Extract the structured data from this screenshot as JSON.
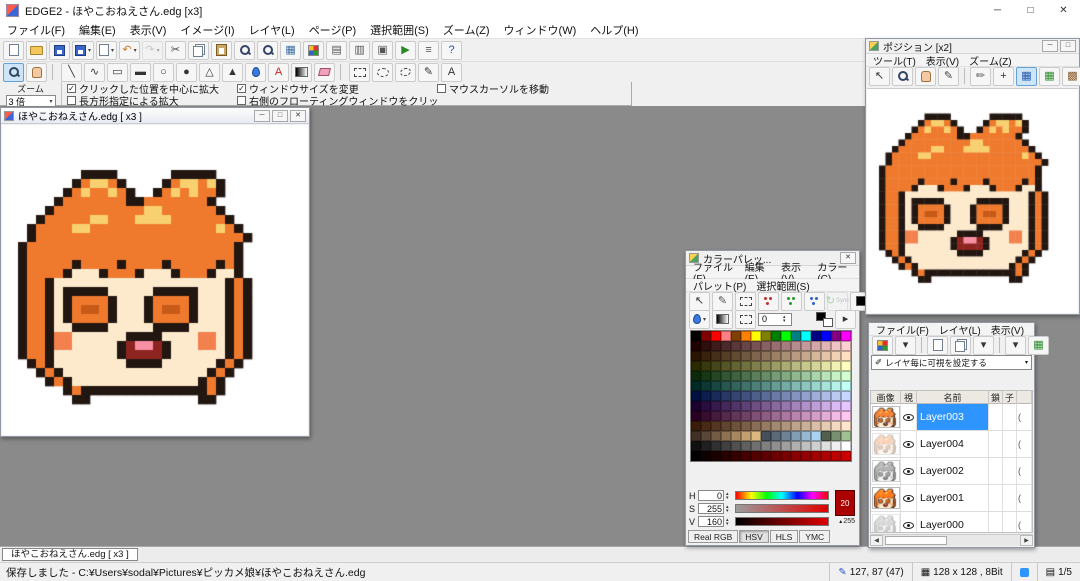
{
  "icons": {
    "dropdown": "▾",
    "check": "✓",
    "up": "▴",
    "down": "▾",
    "left": "◀",
    "right": "▶",
    "expand": "▸"
  },
  "colors": {
    "selected_layer": "#2e95ff",
    "workspace": "#8a8a8a",
    "titlebar": "#ffffff",
    "toolbar": "#f0f0f0",
    "canvas_bg": "#ffffff",
    "pressed_tool": "#cde6f7",
    "current_color": "#aa0000"
  },
  "window": {
    "title": "EDGE2 - ほやこおねえさん.edg [x3]",
    "controls": [
      {
        "name": "minimize-button",
        "glyph": "─"
      },
      {
        "name": "maximize-button",
        "glyph": "□"
      },
      {
        "name": "close-button",
        "glyph": "✕"
      }
    ]
  },
  "menubar": [
    {
      "id": "file",
      "label": "ファイル(F)"
    },
    {
      "id": "edit",
      "label": "編集(E)"
    },
    {
      "id": "view",
      "label": "表示(V)"
    },
    {
      "id": "image",
      "label": "イメージ(I)"
    },
    {
      "id": "layer",
      "label": "レイヤ(L)"
    },
    {
      "id": "page",
      "label": "ページ(P)"
    },
    {
      "id": "selection",
      "label": "選択範囲(S)"
    },
    {
      "id": "zoom",
      "label": "ズーム(Z)"
    },
    {
      "id": "window",
      "label": "ウィンドウ(W)"
    },
    {
      "id": "help",
      "label": "ヘルプ(H)"
    }
  ],
  "toolbar_main": [
    {
      "name": "new-file-button",
      "icon": "page"
    },
    {
      "name": "open-file-button",
      "icon": "folder"
    },
    {
      "name": "save-file-button",
      "icon": "floppy"
    },
    {
      "name": "save-as-button",
      "icon": "floppy",
      "arrow": true
    },
    {
      "name": "export-page-button",
      "icon": "page",
      "arrow": true
    },
    {
      "name": "undo-button",
      "icon": "glyph",
      "glyph": "↶",
      "color": "#c87820",
      "arrow": true
    },
    {
      "name": "redo-button",
      "icon": "glyph",
      "glyph": "↷",
      "color": "#999999",
      "arrow": true,
      "disabled": true
    },
    {
      "name": "cut-button",
      "icon": "glyph",
      "glyph": "✂",
      "color": "#444444"
    },
    {
      "name": "copy-button",
      "icon": "copy"
    },
    {
      "name": "paste-button",
      "icon": "paste"
    },
    {
      "name": "zoom-in-button",
      "icon": "mag"
    },
    {
      "name": "zoom-out-button",
      "icon": "mag"
    },
    {
      "name": "grid-button",
      "icon": "glyph",
      "glyph": "▦",
      "color": "#3a6ea5"
    },
    {
      "name": "palette-button",
      "icon": "palette"
    },
    {
      "name": "pages-button",
      "icon": "glyph",
      "glyph": "▤",
      "color": "#555555"
    },
    {
      "name": "tile-windows-button",
      "icon": "glyph",
      "glyph": "▥",
      "color": "#555555"
    },
    {
      "name": "cascade-windows-button",
      "icon": "glyph",
      "glyph": "▣",
      "color": "#555555"
    },
    {
      "name": "play-animation-button",
      "icon": "glyph",
      "glyph": "▶",
      "color": "#2a8a2a"
    },
    {
      "name": "settings-button",
      "icon": "glyph",
      "glyph": "≡",
      "color": "#555555"
    },
    {
      "name": "help-button",
      "icon": "glyph",
      "glyph": "?",
      "color": "#2255aa"
    }
  ],
  "toolbar_tools": [
    {
      "name": "zoom-tool",
      "icon": "mag",
      "pressed": true
    },
    {
      "name": "hand-tool",
      "icon": "hand"
    },
    {
      "name": "sep"
    },
    {
      "name": "line-tool",
      "icon": "glyph",
      "glyph": "╲",
      "color": "#333333"
    },
    {
      "name": "curve-tool",
      "icon": "glyph",
      "glyph": "∿",
      "color": "#333333"
    },
    {
      "name": "rect-tool",
      "icon": "glyph",
      "glyph": "▭",
      "color": "#333333"
    },
    {
      "name": "filled-rect-tool",
      "icon": "glyph",
      "glyph": "▬",
      "color": "#333333"
    },
    {
      "name": "ellipse-tool",
      "icon": "glyph",
      "glyph": "○",
      "color": "#333333"
    },
    {
      "name": "filled-ellipse-tool",
      "icon": "glyph",
      "glyph": "●",
      "color": "#333333"
    },
    {
      "name": "triangle-tool",
      "icon": "glyph",
      "glyph": "△",
      "color": "#333333"
    },
    {
      "name": "polygon-tool",
      "icon": "glyph",
      "glyph": "▲",
      "color": "#333333"
    },
    {
      "name": "fill-tool",
      "icon": "droplet"
    },
    {
      "name": "text-tool",
      "icon": "glyph",
      "glyph": "A",
      "color": "#cc2222"
    },
    {
      "name": "gradient-tool",
      "icon": "gradient"
    },
    {
      "name": "eraser-tool",
      "icon": "eraser"
    },
    {
      "name": "sep"
    },
    {
      "name": "select-rect-tool",
      "icon": "selrect"
    },
    {
      "name": "select-ellipse-tool",
      "icon": "selell"
    },
    {
      "name": "lasso-tool",
      "icon": "lasso"
    },
    {
      "name": "pen-tool",
      "icon": "glyph",
      "glyph": "✎",
      "color": "#333333"
    },
    {
      "name": "text-tool-2",
      "icon": "glyph",
      "glyph": "A",
      "color": "#333333"
    }
  ],
  "options": {
    "zoom_label": "ズーム",
    "zoom_value": "3 倍",
    "checkboxes": [
      {
        "id": "center-zoom",
        "label": "クリックした位置を中心に拡大",
        "checked": true
      },
      {
        "id": "resize-window",
        "label": "ウィンドウサイズを変更",
        "checked": true
      },
      {
        "id": "move-cursor",
        "label": "マウスカーソルを移動",
        "checked": false
      },
      {
        "id": "rect-zoom",
        "label": "長方形指定による拡大",
        "checked": false
      },
      {
        "id": "clip-floating",
        "label": "右側のフローティングウィンドウをクリッピング",
        "checked": false
      }
    ]
  },
  "canvas_window": {
    "title": "ほやこおねえさん.edg [ x3 ]",
    "controls": [
      {
        "name": "canvas-minimize-button",
        "glyph": "─"
      },
      {
        "name": "canvas-maximize-button",
        "glyph": "□"
      },
      {
        "name": "canvas-close-button",
        "glyph": "✕"
      }
    ]
  },
  "palette_window": {
    "title": "カラーパレッ...",
    "controls": [
      {
        "name": "palette-close-button",
        "glyph": "✕"
      }
    ],
    "menus_row1": [
      {
        "id": "file",
        "label": "ファイル(F)"
      },
      {
        "id": "edit",
        "label": "編集(E)"
      },
      {
        "id": "view",
        "label": "表示(V)"
      },
      {
        "id": "color",
        "label": "カラー(C)"
      }
    ],
    "menus_row2": [
      {
        "id": "palette",
        "label": "パレット(P)"
      },
      {
        "id": "selection",
        "label": "選択範囲(S)"
      }
    ],
    "tools_row1": [
      {
        "name": "palette-cursor-tool",
        "icon": "glyph",
        "glyph": "↖",
        "color": "#333333"
      },
      {
        "name": "palette-pen-tool",
        "icon": "glyph",
        "glyph": "✎",
        "color": "#555555"
      },
      {
        "name": "palette-range-tool",
        "icon": "selrect"
      },
      {
        "name": "droplet-set-red",
        "icon": "droplet3r"
      },
      {
        "name": "droplet-set-green",
        "icon": "droplet3g"
      },
      {
        "name": "droplet-set-blue",
        "icon": "droplet3b"
      },
      {
        "name": "sync-button",
        "icon": "glyph",
        "glyph": "↻",
        "color": "#58a858",
        "label": "Sync",
        "disabled": true
      },
      {
        "name": "current-color-box",
        "icon": "curcolor"
      }
    ],
    "tools_row2": [
      {
        "name": "fill-style-button",
        "icon": "droplet",
        "arrow": true
      },
      {
        "name": "gradient-style-button",
        "icon": "gradient"
      },
      {
        "name": "mask-style-button",
        "icon": "selrect"
      }
    ],
    "index_value": "0",
    "hsv": {
      "h_label": "H",
      "h": "0",
      "s_label": "S",
      "s": "255",
      "v_label": "V",
      "v": "160"
    },
    "swatch_index": "20",
    "swatch_alpha": "255",
    "tabs": [
      {
        "id": "realrgb",
        "label": "Real RGB"
      },
      {
        "id": "hsv",
        "label": "HSV",
        "active": true
      },
      {
        "id": "hls",
        "label": "HLS"
      },
      {
        "id": "ymc",
        "label": "YMC"
      }
    ],
    "grid": {
      "cols": 16,
      "rows": [
        {
          "colors": [
            "#000000",
            "#800000",
            "#ff0000",
            "#ff8080",
            "#804000",
            "#ff8000",
            "#ffff00",
            "#808000",
            "#008000",
            "#00ff00",
            "#008080",
            "#00ffff",
            "#000080",
            "#0000ff",
            "#800080",
            "#ff00ff"
          ]
        },
        {
          "ramp": [
            "#200000",
            "#ffd0d0"
          ]
        },
        {
          "ramp": [
            "#2a1400",
            "#ffdfc0"
          ]
        },
        {
          "ramp": [
            "#2a2a00",
            "#ffffc0"
          ]
        },
        {
          "ramp": [
            "#0a2a0a",
            "#d2ffd2"
          ]
        },
        {
          "ramp": [
            "#002a26",
            "#c2fff6"
          ]
        },
        {
          "ramp": [
            "#001040",
            "#c6d6ff"
          ]
        },
        {
          "ramp": [
            "#1c0030",
            "#e6c6ff"
          ]
        },
        {
          "ramp": [
            "#2a0024",
            "#ffc6f2"
          ]
        },
        {
          "ramp": [
            "#3a1c08",
            "#ffe6cc"
          ]
        },
        {
          "colors": [
            "#403028",
            "#5a4636",
            "#745c44",
            "#8e7252",
            "#a88860",
            "#c2a070",
            "#dcb880",
            "#46505a",
            "#5a6a78",
            "#6e8496",
            "#829eb4",
            "#96b8d2",
            "#aad2f0",
            "#50604a",
            "#78906e",
            "#a0c092"
          ]
        },
        {
          "ramp": [
            "#101010",
            "#ffffff"
          ]
        },
        {
          "ramp": [
            "#000000",
            "#cc0000"
          ]
        }
      ]
    }
  },
  "position_window": {
    "title": "ポジション [x2]",
    "controls": [
      {
        "name": "position-minimize-button",
        "glyph": "─"
      },
      {
        "name": "position-maximize-button",
        "glyph": "□"
      }
    ],
    "menus": [
      {
        "id": "tool",
        "label": "ツール(T)"
      },
      {
        "id": "view",
        "label": "表示(V)"
      },
      {
        "id": "zoom",
        "label": "ズーム(Z)"
      }
    ],
    "tools": [
      {
        "name": "position-cursor-tool",
        "icon": "glyph",
        "glyph": "↖",
        "color": "#333333"
      },
      {
        "name": "position-zoom-tool",
        "icon": "mag"
      },
      {
        "name": "position-hand-tool",
        "icon": "hand"
      },
      {
        "name": "position-pen-tool",
        "icon": "glyph",
        "glyph": "✎",
        "color": "#444444"
      },
      {
        "name": "sep"
      },
      {
        "name": "position-dropper-tool",
        "icon": "glyph",
        "glyph": "✏",
        "color": "#555555"
      },
      {
        "name": "position-crosshair-tool",
        "icon": "glyph",
        "glyph": "+",
        "color": "#333333"
      },
      {
        "name": "position-grid-toggle",
        "icon": "glyph",
        "glyph": "▦",
        "color": "#2255aa",
        "pressed": true
      },
      {
        "name": "position-layers-toggle",
        "icon": "glyph",
        "glyph": "▦",
        "color": "#2a8a2a"
      },
      {
        "name": "position-image-toggle",
        "icon": "glyph",
        "glyph": "▩",
        "color": "#8a5a2a"
      }
    ]
  },
  "layer_window": {
    "menus": [
      {
        "id": "file",
        "label": "ファイル(F)"
      },
      {
        "id": "layer",
        "label": "レイヤ(L)"
      },
      {
        "id": "view",
        "label": "表示(V)"
      }
    ],
    "tools": [
      {
        "name": "layer-palette-button",
        "icon": "palette"
      },
      {
        "name": "layer-palette-menu-button",
        "icon": "glyph",
        "glyph": "▾",
        "color": "#333333"
      },
      {
        "name": "sep"
      },
      {
        "name": "new-layer-button",
        "icon": "page"
      },
      {
        "name": "copy-layer-button",
        "icon": "copy"
      },
      {
        "name": "layer-menu-button",
        "icon": "glyph",
        "glyph": "▾",
        "color": "#333333"
      },
      {
        "name": "sep"
      },
      {
        "name": "merge-menu-button",
        "icon": "glyph",
        "glyph": "▾",
        "color": "#333333"
      },
      {
        "name": "layer-grid-button",
        "icon": "glyph",
        "glyph": "▦",
        "color": "#2a8a2a"
      }
    ],
    "visibility_dropdown": "レイヤ毎に可視を設定する",
    "headers": [
      "画像",
      "視",
      "名前",
      "鎖",
      "子"
    ],
    "clip_text": "(",
    "layers": [
      {
        "name": "Layer003",
        "selected": true,
        "visible": true,
        "thumb_filter": "contrast(1.05)"
      },
      {
        "name": "Layer004",
        "selected": false,
        "visible": true,
        "thumb_filter": "opacity(0.35)"
      },
      {
        "name": "Layer002",
        "selected": false,
        "visible": true,
        "thumb_filter": "grayscale(1) opacity(0.7)"
      },
      {
        "name": "Layer001",
        "selected": false,
        "visible": true,
        "thumb_filter": "saturate(1.3)"
      },
      {
        "name": "Layer000",
        "selected": false,
        "visible": true,
        "thumb_filter": "grayscale(1) opacity(0.35)"
      }
    ]
  },
  "doc_tab": "ほやこおねえさん.edg [ x3 ]",
  "statusbar": {
    "message": "保存しました - C:¥Users¥sodal¥Pictures¥ピッカメ娘¥ほやこおねえさん.edg",
    "coords": "127, 87 (47)",
    "image_info": "128 x 128 , 8Bit",
    "page_info": "1/5"
  },
  "pixel_art": {
    "palette": {
      "k": "#221611",
      "o": "#ef7a2e",
      "d": "#c85a18",
      "y": "#f8d070",
      "s": "#fdeacd",
      "r": "#f2814e",
      "m": "#8e2420",
      "p": "#f890a4",
      "w": "#ffffff"
    },
    "rows": [
      "..............................",
      ".......kkkk......kkkkk........",
      "......koyyok....koyyoyk.......",
      ".....koyooyok..koyoyook.......",
      "....koooooookkoooooook........",
      "...kooooooooooyyooooook.......",
      "..koooooyyoooyyyyooooook......",
      ".kooooyyooooooooooooooyok.....",
      ".koooooooooooooooooooooook....",
      "koooooooooooooooooooooook.....",
      "koooooooooooooooooooooook.....",
      "koooookooookooookoooookok.....",
      "kooookssskoookssskoookssk.....",
      "kookssssssssssssssssssskok....",
      "kookskkkkkssssskkkkkssskok....",
      "kookskooookssskooookssskok....",
      "kookskoddokssskoddokssskok....",
      "kookskooookssskooookssskok....",
      "kooksskkkkssssskkkksssskok....",
      "kookrrsssssskkkkssssrrskok....",
      "kookrrssssskmppmksssrrskok....",
      "kookssssssskmmmmksssssskok....",
      ".koksssssssskkkksssssskok.....",
      "..koksssssssssssssssskok......",
      "...koksssssssssssssskok.......",
      ".....kokkkkkkkkkkkkkkok.......",
      "......kk............kk........"
    ]
  }
}
